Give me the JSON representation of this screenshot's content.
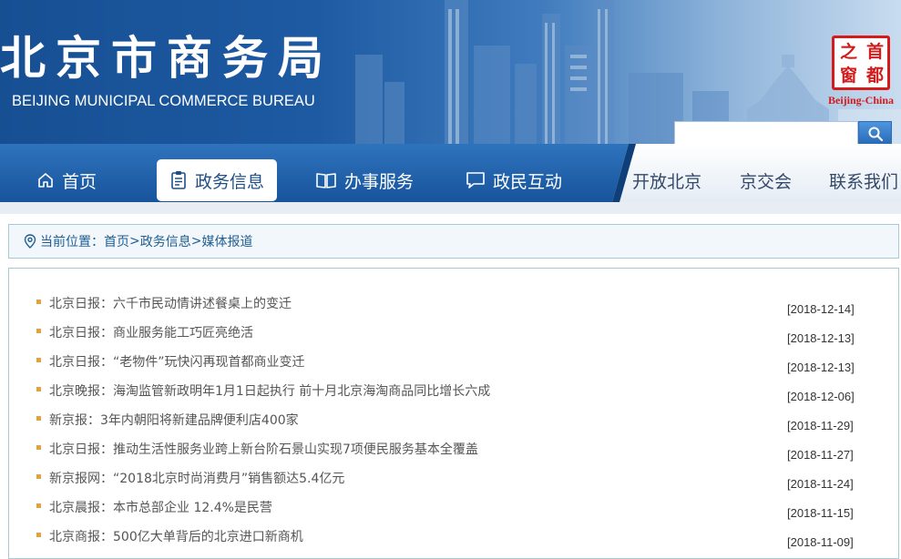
{
  "header": {
    "title": "北京市商务局",
    "subtitle": "BEIJING MUNICIPAL COMMERCE BUREAU",
    "logo": {
      "chars": [
        "之",
        "首",
        "窗",
        "都"
      ],
      "caption": "Beijing-China",
      "color": "#d31b1b"
    },
    "search": {
      "placeholder": "",
      "button_icon": "search-icon"
    }
  },
  "nav": {
    "items": [
      {
        "label": "首页",
        "icon": "home-icon"
      },
      {
        "label": "政务信息",
        "icon": "clipboard-icon"
      },
      {
        "label": "办事服务",
        "icon": "book-icon"
      },
      {
        "label": "政民互动",
        "icon": "chat-icon"
      },
      {
        "label": "开放北京"
      },
      {
        "label": "京交会"
      },
      {
        "label": "联系我们"
      }
    ],
    "active_index": 1
  },
  "breadcrumb": {
    "prefix": "当前位置：",
    "links": [
      "首页",
      "政务信息",
      "媒体报道"
    ],
    "separator": ">"
  },
  "news": [
    {
      "title": "北京日报：六千市民动情讲述餐桌上的变迁",
      "date": "[2018-12-14]"
    },
    {
      "title": "北京日报：商业服务能工巧匠亮绝活",
      "date": "[2018-12-13]"
    },
    {
      "title": "北京日报：“老物件”玩快闪再现首都商业变迁",
      "date": "[2018-12-13]"
    },
    {
      "title": "北京晚报：海淘监管新政明年1月1日起执行  前十月北京海淘商品同比增长六成",
      "date": "[2018-12-06]"
    },
    {
      "title": "新京报：3年内朝阳将新建品牌便利店400家",
      "date": "[2018-11-29]"
    },
    {
      "title": "北京日报：推动生活性服务业跨上新台阶石景山实现7项便民服务基本全覆盖",
      "date": "[2018-11-27]"
    },
    {
      "title": "新京报网：“2018北京时尚消费月”销售额达5.4亿元",
      "date": "[2018-11-24]"
    },
    {
      "title": "北京晨报：本市总部企业  12.4%是民营",
      "date": "[2018-11-15]"
    },
    {
      "title": "北京商报：500亿大单背后的北京进口新商机",
      "date": "[2018-11-09]"
    }
  ],
  "colors": {
    "nav_blue": "#1e5fa8",
    "bullet": "#e3a23c",
    "link": "#1f5d94"
  }
}
